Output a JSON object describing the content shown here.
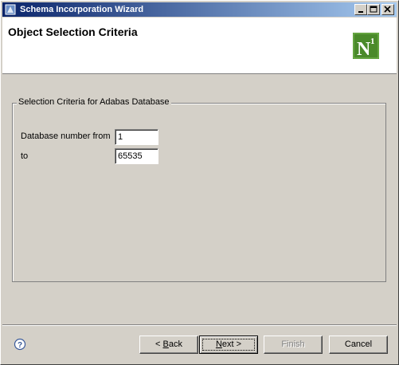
{
  "window": {
    "title": "Schema Incorporation Wizard"
  },
  "header": {
    "title": "Object Selection Criteria",
    "logo_text": "N",
    "logo_superscript": "1"
  },
  "group": {
    "label": "Selection Criteria for Adabas Database",
    "from_label": "Database number from",
    "from_value": "1",
    "to_label": "to",
    "to_value": "65535"
  },
  "buttons": {
    "back_prefix": "< ",
    "back_mnemonic": "B",
    "back_rest": "ack",
    "next_mnemonic": "N",
    "next_rest": "ext >",
    "finish": "Finish",
    "cancel": "Cancel"
  },
  "colors": {
    "title_bar_start": "#0a246a",
    "title_bar_end": "#a6caf0",
    "logo_green": "#4a8a2a",
    "dialog_bg": "#d4d0c8"
  }
}
